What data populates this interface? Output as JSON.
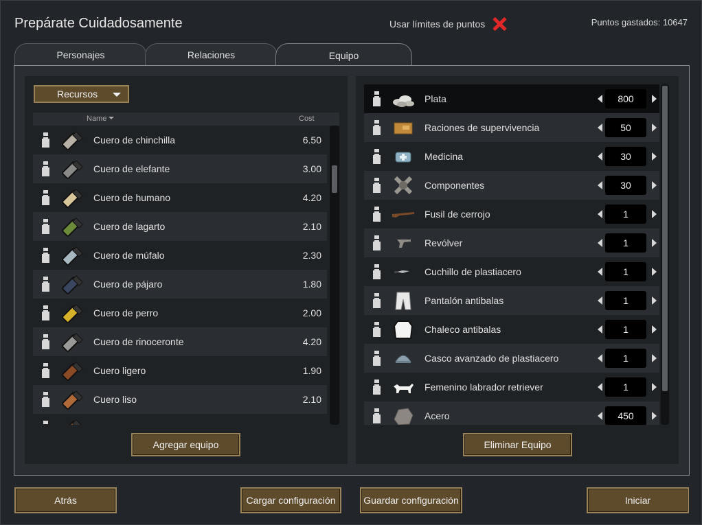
{
  "window": {
    "title": "Prepárate Cuidadosamente",
    "point_limit_label": "Usar límites de puntos",
    "points_spent": "Puntos gastados: 10647"
  },
  "tabs": [
    {
      "label": "Personajes",
      "active": false
    },
    {
      "label": "Relaciones",
      "active": false
    },
    {
      "label": "Equipo",
      "active": true
    }
  ],
  "left_panel": {
    "dropdown_label": "Recursos",
    "col_name": "Name",
    "col_cost": "Cost",
    "add_button": "Agregar equipo",
    "items": [
      {
        "name": "Cuero de chinchilla",
        "cost": "6.50",
        "color": "#b8b2a6"
      },
      {
        "name": "Cuero de elefante",
        "cost": "3.00",
        "color": "#8a8a88"
      },
      {
        "name": "Cuero de humano",
        "cost": "4.20",
        "color": "#d8c59a"
      },
      {
        "name": "Cuero de lagarto",
        "cost": "2.10",
        "color": "#6b8a3a"
      },
      {
        "name": "Cuero de múfalo",
        "cost": "2.30",
        "color": "#a8b8c0"
      },
      {
        "name": "Cuero de pájaro",
        "cost": "1.80",
        "color": "#3a4660"
      },
      {
        "name": "Cuero de perro",
        "cost": "2.00",
        "color": "#d6b12a"
      },
      {
        "name": "Cuero de rinoceronte",
        "cost": "4.20",
        "color": "#9a9a98"
      },
      {
        "name": "Cuero ligero",
        "cost": "1.90",
        "color": "#8a4a26"
      },
      {
        "name": "Cuero liso",
        "cost": "2.10",
        "color": "#b06a3a"
      },
      {
        "name": "",
        "cost": "",
        "color": "#7a4a2a"
      }
    ]
  },
  "right_panel": {
    "remove_button": "Eliminar Equipo",
    "items": [
      {
        "name": "Plata",
        "qty": "800",
        "icon": "silver-icon"
      },
      {
        "name": "Raciones de supervivencia",
        "qty": "50",
        "icon": "ration-icon"
      },
      {
        "name": "Medicina",
        "qty": "30",
        "icon": "medicine-icon"
      },
      {
        "name": "Componentes",
        "qty": "30",
        "icon": "components-icon"
      },
      {
        "name": "Fusil de cerrojo",
        "qty": "1",
        "icon": "rifle-icon"
      },
      {
        "name": "Revólver",
        "qty": "1",
        "icon": "revolver-icon"
      },
      {
        "name": "Cuchillo de plastiacero",
        "qty": "1",
        "icon": "knife-icon"
      },
      {
        "name": "Pantalón antibalas",
        "qty": "1",
        "icon": "pants-icon"
      },
      {
        "name": "Chaleco antibalas",
        "qty": "1",
        "icon": "vest-icon"
      },
      {
        "name": "Casco avanzado de plastiacero",
        "qty": "1",
        "icon": "helmet-icon"
      },
      {
        "name": "Femenino labrador retriever",
        "qty": "1",
        "icon": "dog-icon"
      },
      {
        "name": "Acero",
        "qty": "450",
        "icon": "steel-icon"
      }
    ]
  },
  "footer": {
    "back": "Atrás",
    "load": "Cargar configuración",
    "save": "Guardar configuración",
    "start": "Iniciar"
  }
}
